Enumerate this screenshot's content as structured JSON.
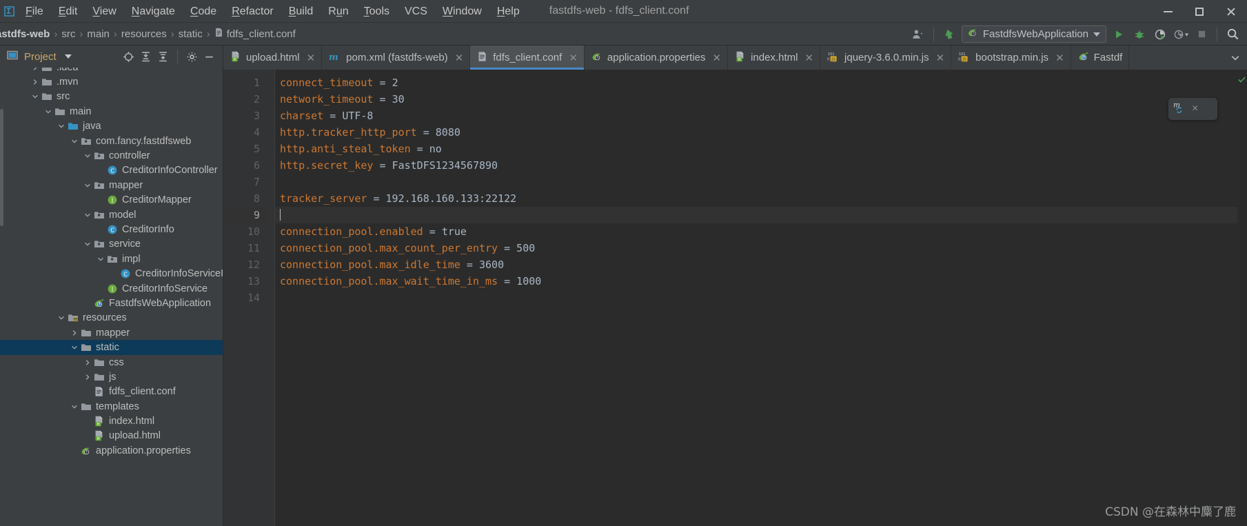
{
  "window": {
    "title": "fastdfs-web - fdfs_client.conf",
    "controls": {
      "minimize": "minimize",
      "maximize": "maximize",
      "close": "close"
    }
  },
  "menu": [
    {
      "label": "File",
      "mnemonic": "F"
    },
    {
      "label": "Edit",
      "mnemonic": "E"
    },
    {
      "label": "View",
      "mnemonic": "V"
    },
    {
      "label": "Navigate",
      "mnemonic": "N"
    },
    {
      "label": "Code",
      "mnemonic": "C"
    },
    {
      "label": "Refactor",
      "mnemonic": "R"
    },
    {
      "label": "Build",
      "mnemonic": "B"
    },
    {
      "label": "Run",
      "mnemonic": "u"
    },
    {
      "label": "Tools",
      "mnemonic": "T"
    },
    {
      "label": "VCS",
      "mnemonic": ""
    },
    {
      "label": "Window",
      "mnemonic": "W"
    },
    {
      "label": "Help",
      "mnemonic": "H"
    }
  ],
  "breadcrumb": {
    "items": [
      "astdfs-web",
      "src",
      "main",
      "resources",
      "static",
      "fdfs_client.conf"
    ],
    "separator": "›"
  },
  "toolbar": {
    "run_config_label": "FastdfsWebApplication",
    "icons": [
      "user-avatar-icon",
      "updates-icon",
      "run-icon",
      "debug-icon",
      "coverage-icon",
      "profile-icon",
      "stop-icon",
      "search-everywhere-icon"
    ]
  },
  "sidebar": {
    "title": "Project",
    "tools": [
      "locate-icon",
      "expand-all-icon",
      "collapse-all-icon",
      "settings-icon",
      "hide-icon"
    ],
    "tree": [
      {
        "label": ".idea",
        "depth": 2,
        "arrow": "right",
        "icon": "folder",
        "selected": false,
        "clipped": true
      },
      {
        "label": ".mvn",
        "depth": 2,
        "arrow": "right",
        "icon": "folder",
        "selected": false
      },
      {
        "label": "src",
        "depth": 2,
        "arrow": "down",
        "icon": "folder",
        "selected": false
      },
      {
        "label": "main",
        "depth": 3,
        "arrow": "down",
        "icon": "folder",
        "selected": false
      },
      {
        "label": "java",
        "depth": 4,
        "arrow": "down",
        "icon": "folder-source",
        "selected": false
      },
      {
        "label": "com.fancy.fastdfsweb",
        "depth": 5,
        "arrow": "down",
        "icon": "package",
        "selected": false
      },
      {
        "label": "controller",
        "depth": 6,
        "arrow": "down",
        "icon": "package",
        "selected": false
      },
      {
        "label": "CreditorInfoController",
        "depth": 7,
        "arrow": "none",
        "icon": "class",
        "selected": false
      },
      {
        "label": "mapper",
        "depth": 6,
        "arrow": "down",
        "icon": "package",
        "selected": false
      },
      {
        "label": "CreditorMapper",
        "depth": 7,
        "arrow": "none",
        "icon": "interface",
        "selected": false
      },
      {
        "label": "model",
        "depth": 6,
        "arrow": "down",
        "icon": "package",
        "selected": false
      },
      {
        "label": "CreditorInfo",
        "depth": 7,
        "arrow": "none",
        "icon": "class",
        "selected": false
      },
      {
        "label": "service",
        "depth": 6,
        "arrow": "down",
        "icon": "package",
        "selected": false
      },
      {
        "label": "impl",
        "depth": 7,
        "arrow": "down",
        "icon": "package",
        "selected": false
      },
      {
        "label": "CreditorInfoServiceImpl",
        "depth": 8,
        "arrow": "none",
        "icon": "class",
        "selected": false
      },
      {
        "label": "CreditorInfoService",
        "depth": 7,
        "arrow": "none",
        "icon": "interface",
        "selected": false
      },
      {
        "label": "FastdfsWebApplication",
        "depth": 6,
        "arrow": "none",
        "icon": "spring-boot",
        "selected": false
      },
      {
        "label": "resources",
        "depth": 4,
        "arrow": "down",
        "icon": "folder-resources",
        "selected": false
      },
      {
        "label": "mapper",
        "depth": 5,
        "arrow": "right",
        "icon": "folder",
        "selected": false
      },
      {
        "label": "static",
        "depth": 5,
        "arrow": "down",
        "icon": "folder",
        "selected": true
      },
      {
        "label": "css",
        "depth": 6,
        "arrow": "right",
        "icon": "folder",
        "selected": false
      },
      {
        "label": "js",
        "depth": 6,
        "arrow": "right",
        "icon": "folder",
        "selected": false
      },
      {
        "label": "fdfs_client.conf",
        "depth": 6,
        "arrow": "none",
        "icon": "conf-file",
        "selected": false
      },
      {
        "label": "templates",
        "depth": 5,
        "arrow": "down",
        "icon": "folder",
        "selected": false
      },
      {
        "label": "index.html",
        "depth": 6,
        "arrow": "none",
        "icon": "html-file",
        "selected": false
      },
      {
        "label": "upload.html",
        "depth": 6,
        "arrow": "none",
        "icon": "html-file",
        "selected": false
      },
      {
        "label": "application.properties",
        "depth": 5,
        "arrow": "none",
        "icon": "spring-properties",
        "selected": false
      }
    ]
  },
  "tabs": [
    {
      "label": "upload.html",
      "icon": "html-file",
      "active": false
    },
    {
      "label": "pom.xml (fastdfs-web)",
      "icon": "maven-file",
      "active": false
    },
    {
      "label": "fdfs_client.conf",
      "icon": "conf-file",
      "active": true
    },
    {
      "label": "application.properties",
      "icon": "spring-properties",
      "active": false
    },
    {
      "label": "index.html",
      "icon": "html-file",
      "active": false
    },
    {
      "label": "jquery-3.6.0.min.js",
      "icon": "js-file",
      "active": false
    },
    {
      "label": "bootstrap.min.js",
      "icon": "js-file",
      "active": false
    },
    {
      "label": "Fastdf",
      "icon": "spring-boot",
      "active": false
    }
  ],
  "editor": {
    "current_line": 9,
    "lines": [
      {
        "n": 1,
        "key": "connect_timeout",
        "op": " = ",
        "value": "2"
      },
      {
        "n": 2,
        "key": "network_timeout",
        "op": " = ",
        "value": "30"
      },
      {
        "n": 3,
        "key": "charset",
        "op": " = ",
        "value": "UTF-8"
      },
      {
        "n": 4,
        "key": "http.tracker_http_port",
        "op": " = ",
        "value": "8080"
      },
      {
        "n": 5,
        "key": "http.anti_steal_token",
        "op": " = ",
        "value": "no"
      },
      {
        "n": 6,
        "key": "http.secret_key",
        "op": " = ",
        "value": "FastDFS1234567890"
      },
      {
        "n": 7,
        "key": "",
        "op": "",
        "value": ""
      },
      {
        "n": 8,
        "key": "tracker_server",
        "op": " = ",
        "value": "192.168.160.133:22122"
      },
      {
        "n": 9,
        "key": "",
        "op": "",
        "value": ""
      },
      {
        "n": 10,
        "key": "connection_pool.enabled",
        "op": " = ",
        "value": "true"
      },
      {
        "n": 11,
        "key": "connection_pool.max_count_per_entry",
        "op": " = ",
        "value": "500"
      },
      {
        "n": 12,
        "key": "connection_pool.max_idle_time",
        "op": " = ",
        "value": "3600"
      },
      {
        "n": 13,
        "key": "connection_pool.max_wait_time_in_ms",
        "op": " = ",
        "value": "1000"
      },
      {
        "n": 14,
        "key": "",
        "op": "",
        "value": ""
      }
    ]
  },
  "maven_popup": {
    "icon": "maven-reload-icon",
    "close": "×"
  },
  "watermark": "CSDN @在森林中麋了鹿",
  "colors": {
    "background": "#3c3f41",
    "editor_background": "#2b2b2b",
    "selection": "#0d3a58",
    "key_color": "#cc7832",
    "value_color": "#a9b7c6",
    "accent_blue": "#4a88c7",
    "title_orange": "#c9a76a",
    "run_green": "#499c54"
  }
}
